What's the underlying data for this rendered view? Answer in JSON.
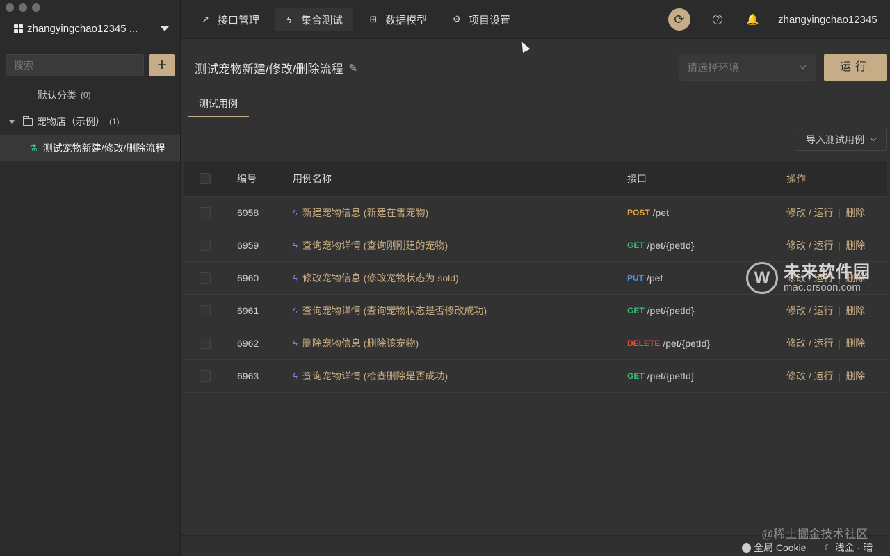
{
  "sidebar": {
    "workspace_name": "zhangyingchao12345 ...",
    "search_placeholder": "搜索",
    "add_label": "+",
    "tree": [
      {
        "label": "默认分类",
        "count": "(0)"
      },
      {
        "label": "宠物店（示例）",
        "count": "(1)"
      },
      {
        "label": "测试宠物新建/修改/删除流程"
      }
    ]
  },
  "topbar": {
    "tabs": [
      {
        "label": "接口管理",
        "icon": "rocket-icon"
      },
      {
        "label": "集合测试",
        "icon": "bolt-icon"
      },
      {
        "label": "数据模型",
        "icon": "model-icon"
      },
      {
        "label": "项目设置",
        "icon": "gear-icon"
      }
    ],
    "sync_glyph": "⟳",
    "help_glyph": "?",
    "bell_glyph": "🔔",
    "username": "zhangyingchao12345"
  },
  "main": {
    "title": "测试宠物新建/修改/删除流程",
    "env_placeholder": "请选择环境",
    "run_label": "运行",
    "tab_label": "测试用例",
    "import_label": "导入测试用例"
  },
  "table": {
    "columns": [
      "编号",
      "用例名称",
      "接口",
      "操作"
    ],
    "ops": {
      "edit_run": "修改 / 运行",
      "delete": "删除"
    },
    "rows": [
      {
        "id": "6958",
        "name": "新建宠物信息 (新建在售宠物)",
        "method": "POST",
        "method_color": "#e8a33d",
        "path": "/pet"
      },
      {
        "id": "6959",
        "name": "查询宠物详情 (查询刚刚建的宠物)",
        "method": "GET",
        "method_color": "#3cb878",
        "path": "/pet/{petId}"
      },
      {
        "id": "6960",
        "name": "修改宠物信息 (修改宠物状态为 sold)",
        "method": "PUT",
        "method_color": "#4a90e2",
        "path": "/pet"
      },
      {
        "id": "6961",
        "name": "查询宠物详情 (查询宠物状态是否修改成功)",
        "method": "GET",
        "method_color": "#3cb878",
        "path": "/pet/{petId}"
      },
      {
        "id": "6962",
        "name": "删除宠物信息 (删除该宠物)",
        "method": "DELETE",
        "method_color": "#e5533d",
        "path": "/pet/{petId}"
      },
      {
        "id": "6963",
        "name": "查询宠物详情 (检查删除是否成功)",
        "method": "GET",
        "method_color": "#3cb878",
        "path": "/pet/{petId}"
      }
    ]
  },
  "footer": {
    "cookie_label": "全局 Cookie",
    "theme_label": "浅金 · 暗"
  },
  "watermark": {
    "logo_glyph": "W",
    "site_cn": "未来软件园",
    "site_url": "mac.orsoon.com",
    "community": "@稀土掘金技术社区"
  },
  "colors": {
    "accent": "#c7ad87",
    "link": "#c9ad82",
    "background": "#323232",
    "sidebar": "#2b2b2b"
  }
}
